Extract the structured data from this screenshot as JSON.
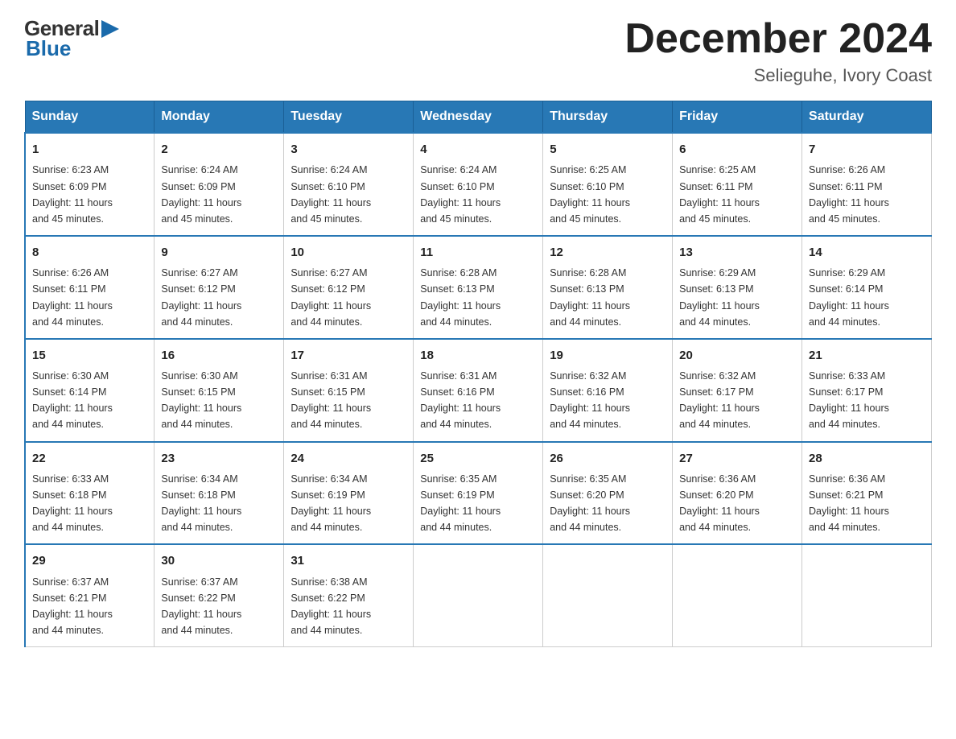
{
  "header": {
    "logo_general": "General",
    "logo_blue": "Blue",
    "month_title": "December 2024",
    "location": "Selieguhe, Ivory Coast"
  },
  "days_of_week": [
    "Sunday",
    "Monday",
    "Tuesday",
    "Wednesday",
    "Thursday",
    "Friday",
    "Saturday"
  ],
  "weeks": [
    [
      {
        "day": "1",
        "sunrise": "6:23 AM",
        "sunset": "6:09 PM",
        "daylight": "11 hours and 45 minutes."
      },
      {
        "day": "2",
        "sunrise": "6:24 AM",
        "sunset": "6:09 PM",
        "daylight": "11 hours and 45 minutes."
      },
      {
        "day": "3",
        "sunrise": "6:24 AM",
        "sunset": "6:10 PM",
        "daylight": "11 hours and 45 minutes."
      },
      {
        "day": "4",
        "sunrise": "6:24 AM",
        "sunset": "6:10 PM",
        "daylight": "11 hours and 45 minutes."
      },
      {
        "day": "5",
        "sunrise": "6:25 AM",
        "sunset": "6:10 PM",
        "daylight": "11 hours and 45 minutes."
      },
      {
        "day": "6",
        "sunrise": "6:25 AM",
        "sunset": "6:11 PM",
        "daylight": "11 hours and 45 minutes."
      },
      {
        "day": "7",
        "sunrise": "6:26 AM",
        "sunset": "6:11 PM",
        "daylight": "11 hours and 45 minutes."
      }
    ],
    [
      {
        "day": "8",
        "sunrise": "6:26 AM",
        "sunset": "6:11 PM",
        "daylight": "11 hours and 44 minutes."
      },
      {
        "day": "9",
        "sunrise": "6:27 AM",
        "sunset": "6:12 PM",
        "daylight": "11 hours and 44 minutes."
      },
      {
        "day": "10",
        "sunrise": "6:27 AM",
        "sunset": "6:12 PM",
        "daylight": "11 hours and 44 minutes."
      },
      {
        "day": "11",
        "sunrise": "6:28 AM",
        "sunset": "6:13 PM",
        "daylight": "11 hours and 44 minutes."
      },
      {
        "day": "12",
        "sunrise": "6:28 AM",
        "sunset": "6:13 PM",
        "daylight": "11 hours and 44 minutes."
      },
      {
        "day": "13",
        "sunrise": "6:29 AM",
        "sunset": "6:13 PM",
        "daylight": "11 hours and 44 minutes."
      },
      {
        "day": "14",
        "sunrise": "6:29 AM",
        "sunset": "6:14 PM",
        "daylight": "11 hours and 44 minutes."
      }
    ],
    [
      {
        "day": "15",
        "sunrise": "6:30 AM",
        "sunset": "6:14 PM",
        "daylight": "11 hours and 44 minutes."
      },
      {
        "day": "16",
        "sunrise": "6:30 AM",
        "sunset": "6:15 PM",
        "daylight": "11 hours and 44 minutes."
      },
      {
        "day": "17",
        "sunrise": "6:31 AM",
        "sunset": "6:15 PM",
        "daylight": "11 hours and 44 minutes."
      },
      {
        "day": "18",
        "sunrise": "6:31 AM",
        "sunset": "6:16 PM",
        "daylight": "11 hours and 44 minutes."
      },
      {
        "day": "19",
        "sunrise": "6:32 AM",
        "sunset": "6:16 PM",
        "daylight": "11 hours and 44 minutes."
      },
      {
        "day": "20",
        "sunrise": "6:32 AM",
        "sunset": "6:17 PM",
        "daylight": "11 hours and 44 minutes."
      },
      {
        "day": "21",
        "sunrise": "6:33 AM",
        "sunset": "6:17 PM",
        "daylight": "11 hours and 44 minutes."
      }
    ],
    [
      {
        "day": "22",
        "sunrise": "6:33 AM",
        "sunset": "6:18 PM",
        "daylight": "11 hours and 44 minutes."
      },
      {
        "day": "23",
        "sunrise": "6:34 AM",
        "sunset": "6:18 PM",
        "daylight": "11 hours and 44 minutes."
      },
      {
        "day": "24",
        "sunrise": "6:34 AM",
        "sunset": "6:19 PM",
        "daylight": "11 hours and 44 minutes."
      },
      {
        "day": "25",
        "sunrise": "6:35 AM",
        "sunset": "6:19 PM",
        "daylight": "11 hours and 44 minutes."
      },
      {
        "day": "26",
        "sunrise": "6:35 AM",
        "sunset": "6:20 PM",
        "daylight": "11 hours and 44 minutes."
      },
      {
        "day": "27",
        "sunrise": "6:36 AM",
        "sunset": "6:20 PM",
        "daylight": "11 hours and 44 minutes."
      },
      {
        "day": "28",
        "sunrise": "6:36 AM",
        "sunset": "6:21 PM",
        "daylight": "11 hours and 44 minutes."
      }
    ],
    [
      {
        "day": "29",
        "sunrise": "6:37 AM",
        "sunset": "6:21 PM",
        "daylight": "11 hours and 44 minutes."
      },
      {
        "day": "30",
        "sunrise": "6:37 AM",
        "sunset": "6:22 PM",
        "daylight": "11 hours and 44 minutes."
      },
      {
        "day": "31",
        "sunrise": "6:38 AM",
        "sunset": "6:22 PM",
        "daylight": "11 hours and 44 minutes."
      },
      null,
      null,
      null,
      null
    ]
  ],
  "labels": {
    "sunrise": "Sunrise:",
    "sunset": "Sunset:",
    "daylight": "Daylight:"
  }
}
